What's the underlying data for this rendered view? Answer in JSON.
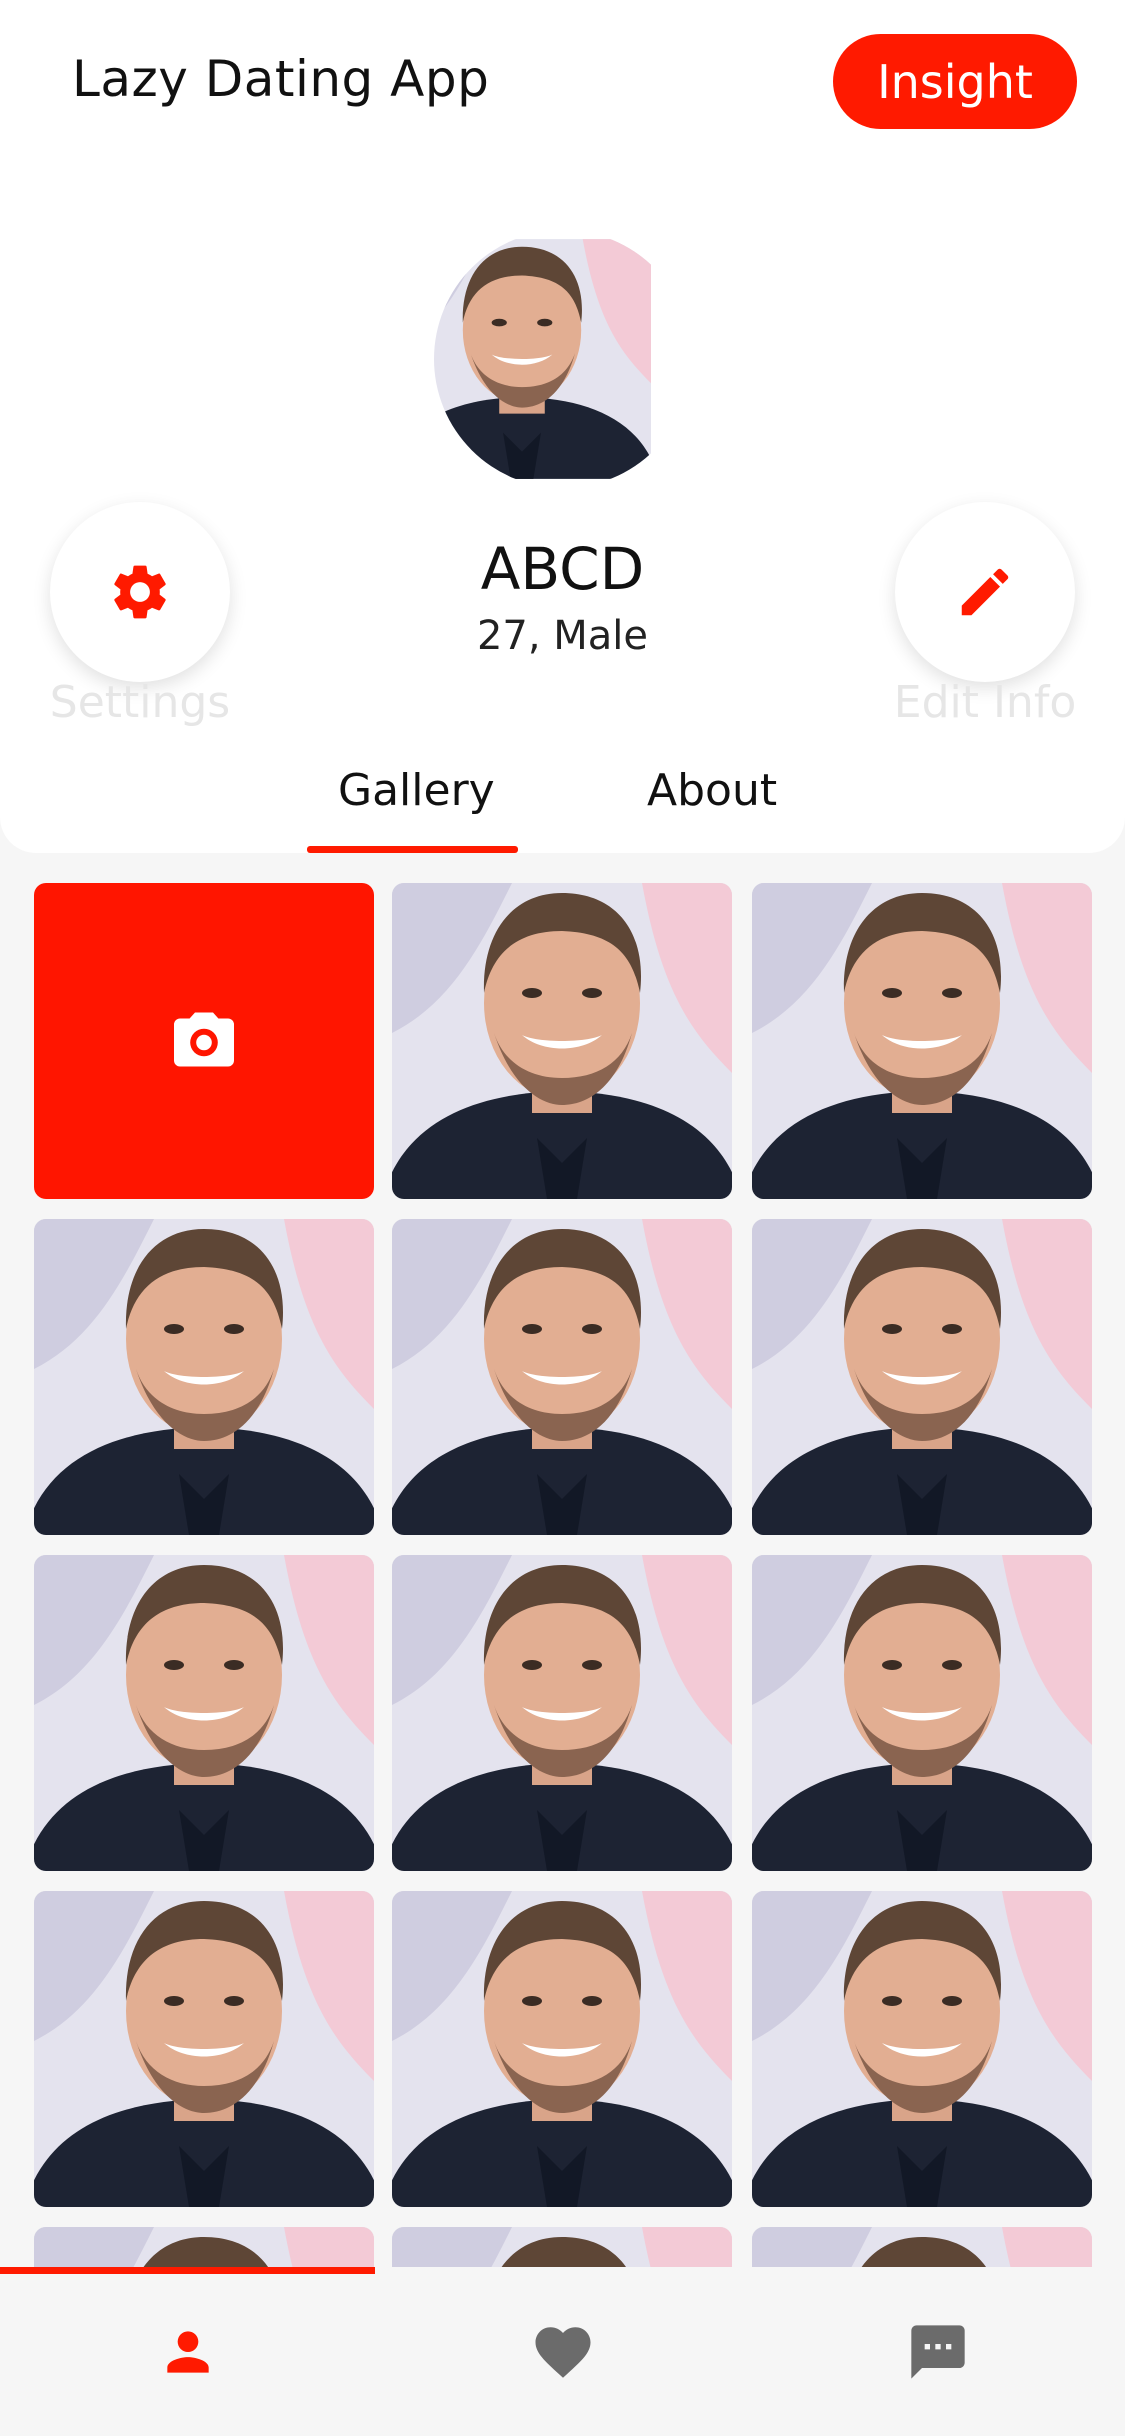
{
  "header": {
    "app_title": "Lazy Dating App",
    "insight_label": "Insight"
  },
  "profile": {
    "name": "ABCD",
    "subtitle": "27, Male",
    "settings_label": "Settings",
    "edit_label": "Edit Info"
  },
  "tabs": [
    {
      "label": "Gallery",
      "active": true
    },
    {
      "label": "About",
      "active": false
    }
  ],
  "gallery": {
    "add_photo_icon": "camera-icon",
    "photo_count": 14
  },
  "bottom_nav": [
    {
      "icon": "person-icon",
      "active": true
    },
    {
      "icon": "heart-icon",
      "active": false
    },
    {
      "icon": "chat-icon",
      "active": false
    }
  ],
  "colors": {
    "accent": "#ff1a00",
    "inactive_icon": "#6b6b6b",
    "label_faded": "#e6e6e6"
  }
}
